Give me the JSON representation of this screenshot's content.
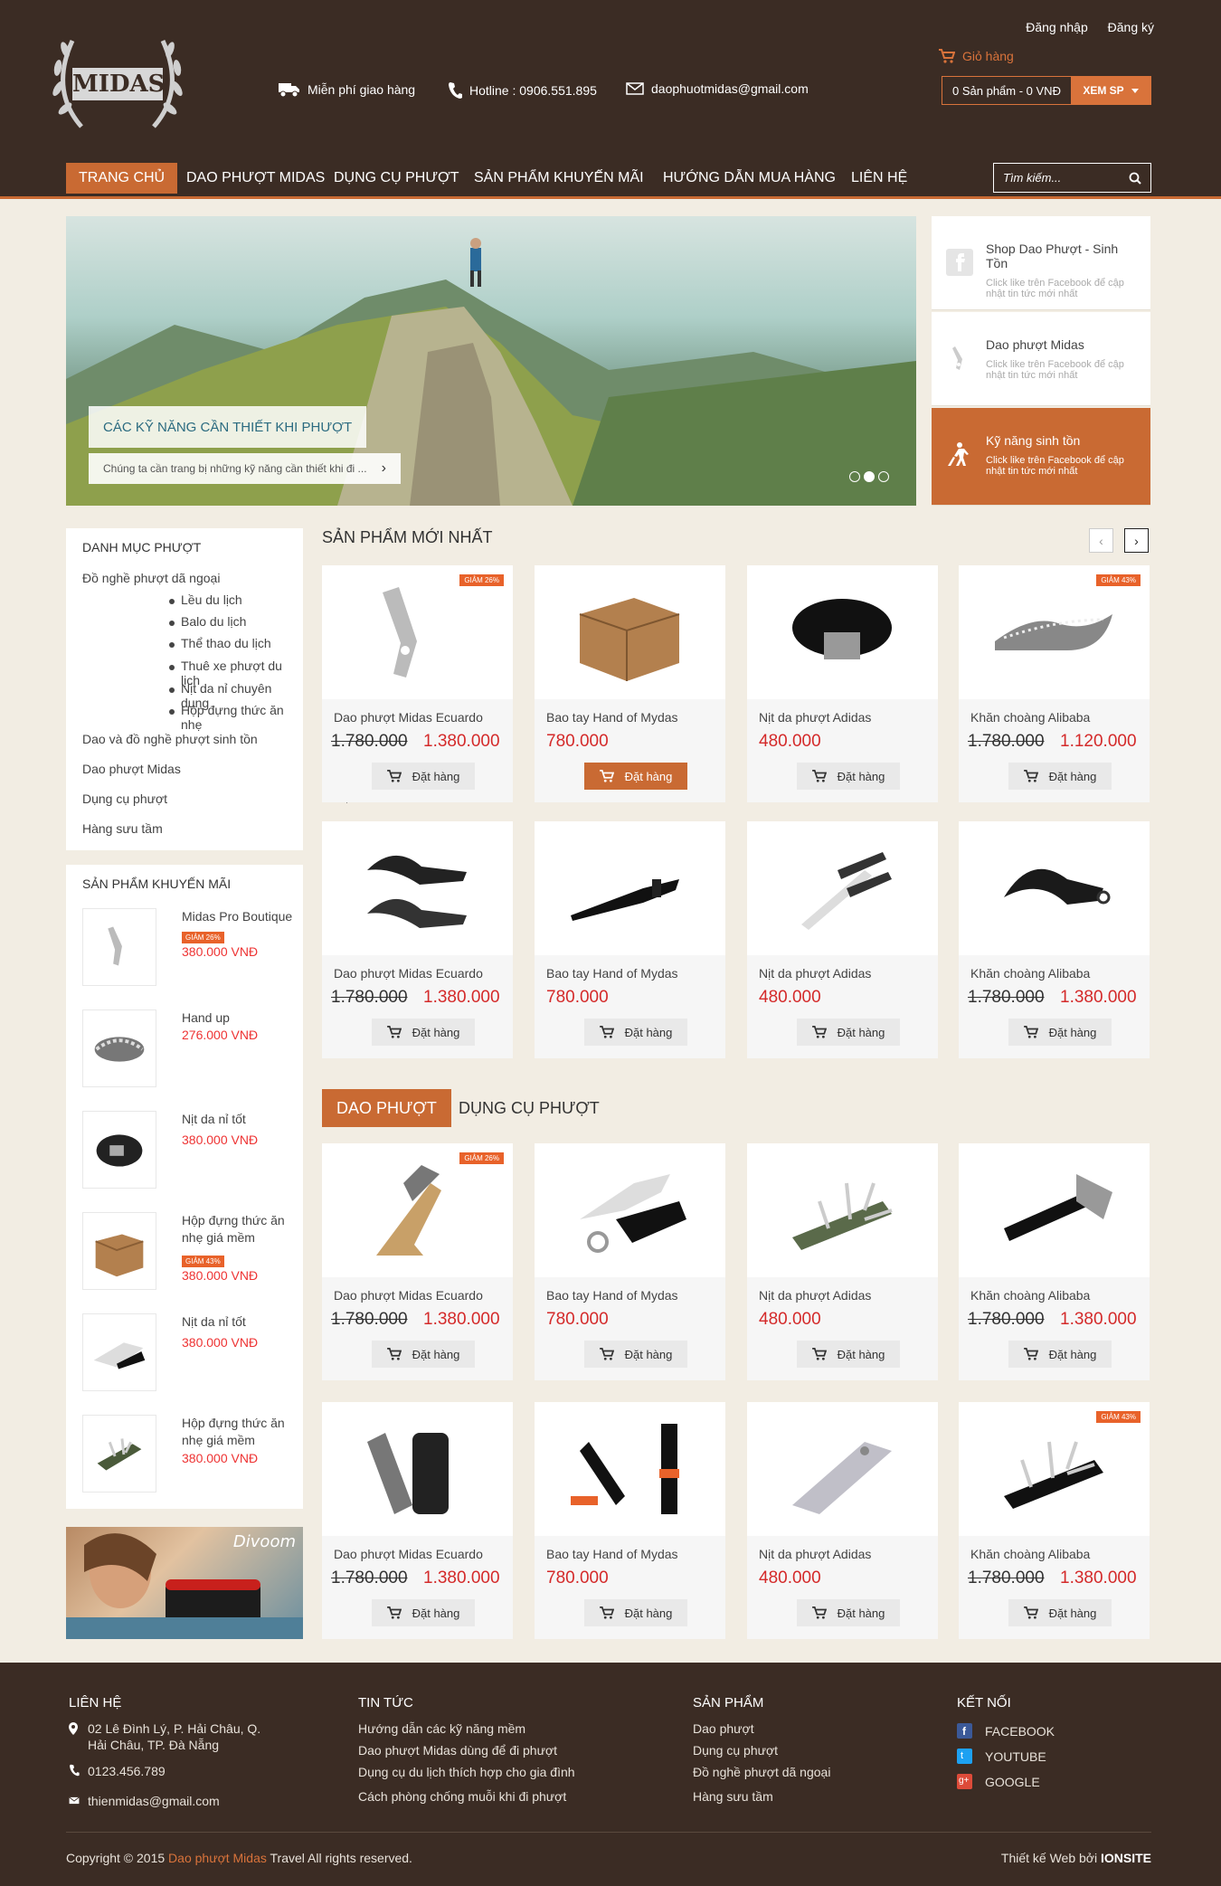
{
  "header": {
    "logo_text": "MIDAS",
    "login": "Đăng nhập",
    "register": "Đăng ký",
    "free_ship": "Miễn phí giao hàng",
    "hotline": "Hotline : 0906.551.895",
    "email": "daophuotmidas@gmail.com",
    "cart_label": "Giỏ hàng",
    "cart_count": "0 Sản phẩm - 0 VNĐ",
    "cart_view": "XEM SP"
  },
  "nav": {
    "items": [
      "Trang chủ",
      "Dao phượt Midas",
      "Dụng cụ phượt",
      "Sản phẩm khuyến mãi",
      "Hướng dẫn mua hàng",
      "Liên hệ"
    ],
    "search_placeholder": "Tìm kiếm..."
  },
  "hero": {
    "title": "CÁC KỸ NĂNG CẦN THIẾT KHI PHƯỢT",
    "desc": "Chúng ta cần trang bị những kỹ năng cần thiết khi đi ...",
    "cards": [
      {
        "title": "Shop Dao Phượt - Sinh Tồn",
        "desc": "Click like trên Facebook để cập nhật tin tức mới nhất"
      },
      {
        "title": "Dao phượt Midas",
        "desc": "Click like trên Facebook để cập nhật tin tức mới nhất"
      },
      {
        "title": "Kỹ năng sinh tồn",
        "desc": "Click like trên Facebook để cập nhật tin tức mới nhất"
      }
    ]
  },
  "categories": {
    "title": "DANH MỤC PHƯỢT",
    "main": "Đồ nghề phượt dã ngoại",
    "sub": [
      "Lều du lịch",
      "Balo du lịch",
      "Thể thao du lịch",
      "Thuê xe phượt du lịch",
      "Nịt da nỉ chuyên dụng",
      "Hộp đựng thức ăn nhẹ"
    ],
    "others": [
      "Dao và đồ nghề phượt sinh tồn",
      "Dao phượt Midas",
      "Dụng cụ phượt",
      "Hàng sưu tầm"
    ]
  },
  "promo": {
    "title": "SẢN PHẨM KHUYẾN MÃI",
    "items": [
      {
        "name": "Midas Pro Boutique",
        "badge": "GIẢM 26%",
        "price": "380.000 VNĐ"
      },
      {
        "name": "Hand up",
        "badge": "",
        "price": "276.000 VNĐ"
      },
      {
        "name": "Nịt da nỉ tốt",
        "badge": "",
        "price": "380.000 VNĐ"
      },
      {
        "name": "Hộp đựng thức ăn nhẹ giá mềm",
        "badge": "GIẢM 43%",
        "price": "380.000 VNĐ"
      },
      {
        "name": "Nịt da nỉ tốt",
        "badge": "",
        "price": "380.000 VNĐ"
      },
      {
        "name": "Hộp đựng thức ăn nhẹ giá mềm",
        "badge": "",
        "price": "380.000 VNĐ"
      }
    ]
  },
  "banner": {
    "brand": "Divoom"
  },
  "newest": {
    "title": "SẢN PHẨM MỚI NHẤT",
    "products": [
      {
        "name": "Dao phượt Midas Ecuardo",
        "old": "1.780.000",
        "price": "1.380.000",
        "badge": "GIẢM 26%",
        "buy": "Đặt hàng"
      },
      {
        "name": "Bao tay Hand of Mydas",
        "old": "",
        "price": "780.000",
        "badge": "",
        "buy": "Đặt hàng"
      },
      {
        "name": "Nịt da phượt Adidas",
        "old": "",
        "price": "480.000",
        "badge": "",
        "buy": "Đặt hàng"
      },
      {
        "name": "Khăn choàng Alibaba",
        "old": "1.780.000",
        "price": "1.120.000",
        "badge": "GIẢM 43%",
        "buy": "Đặt hàng"
      },
      {
        "name": "Dao phượt Midas Ecuardo",
        "old": "1.780.000",
        "price": "1.380.000",
        "badge": "",
        "buy": "Đặt hàng"
      },
      {
        "name": "Bao tay Hand of Mydas",
        "old": "",
        "price": "780.000",
        "badge": "",
        "buy": "Đặt hàng"
      },
      {
        "name": "Nịt da phượt Adidas",
        "old": "",
        "price": "480.000",
        "badge": "",
        "buy": "Đặt hàng"
      },
      {
        "name": "Khăn choàng Alibaba",
        "old": "1.780.000",
        "price": "1.380.000",
        "badge": "",
        "buy": "Đặt hàng"
      }
    ]
  },
  "tabs": {
    "active": "DAO PHƯỢT",
    "other": "DỤNG CỤ PHƯỢT"
  },
  "knives": {
    "products": [
      {
        "name": "Dao phượt Midas Ecuardo",
        "old": "1.780.000",
        "price": "1.380.000",
        "badge": "GIẢM 26%",
        "buy": "Đặt hàng"
      },
      {
        "name": "Bao tay Hand of Mydas",
        "old": "",
        "price": "780.000",
        "badge": "",
        "buy": "Đặt hàng"
      },
      {
        "name": "Nịt da phượt Adidas",
        "old": "",
        "price": "480.000",
        "badge": "",
        "buy": "Đặt hàng"
      },
      {
        "name": "Khăn choàng Alibaba",
        "old": "1.780.000",
        "price": "1.380.000",
        "badge": "",
        "buy": "Đặt hàng"
      },
      {
        "name": "Dao phượt Midas Ecuardo",
        "old": "1.780.000",
        "price": "1.380.000",
        "badge": "",
        "buy": "Đặt hàng"
      },
      {
        "name": "Bao tay Hand of Mydas",
        "old": "",
        "price": "780.000",
        "badge": "",
        "buy": "Đặt hàng"
      },
      {
        "name": "Nịt da phượt Adidas",
        "old": "",
        "price": "480.000",
        "badge": "",
        "buy": "Đặt hàng"
      },
      {
        "name": "Khăn choàng Alibaba",
        "old": "1.780.000",
        "price": "1.380.000",
        "badge": "GIẢM 43%",
        "buy": "Đặt hàng"
      }
    ]
  },
  "footer": {
    "contact_title": "LIÊN HỆ",
    "address": "02 Lê Đình Lý, P. Hải Châu, Q. Hải Châu, TP. Đà Nẵng",
    "phone": "0123.456.789",
    "email": "thienmidas@gmail.com",
    "news_title": "TIN TỨC",
    "news": [
      "Hướng dẫn các kỹ năng mềm",
      "Dao phượt Midas dùng để đi phượt",
      "Dụng cụ du lịch thích hợp cho gia đình",
      "Cách phòng chống muỗi khi đi phượt"
    ],
    "products_title": "SẢN PHẨM",
    "products": [
      "Dao phượt",
      "Dụng cụ phượt",
      "Đồ nghề phượt dã ngoại",
      "Hàng sưu tầm"
    ],
    "connect_title": "KẾT NỐI",
    "social": [
      "FACEBOOK",
      "YOUTUBE",
      "GOOGLE"
    ],
    "copyright_pre": "Copyright © 2015",
    "copyright_link": "Dao phượt Midas",
    "copyright_post": "Travel All rights reserved.",
    "credit_pre": "Thiết kế Web bởi",
    "credit_brand": "IONSITE"
  },
  "colors": {
    "accent": "#c96a33",
    "header_bg": "#3b2c24",
    "price": "#d42a2a",
    "page_bg": "#f2ede3"
  }
}
